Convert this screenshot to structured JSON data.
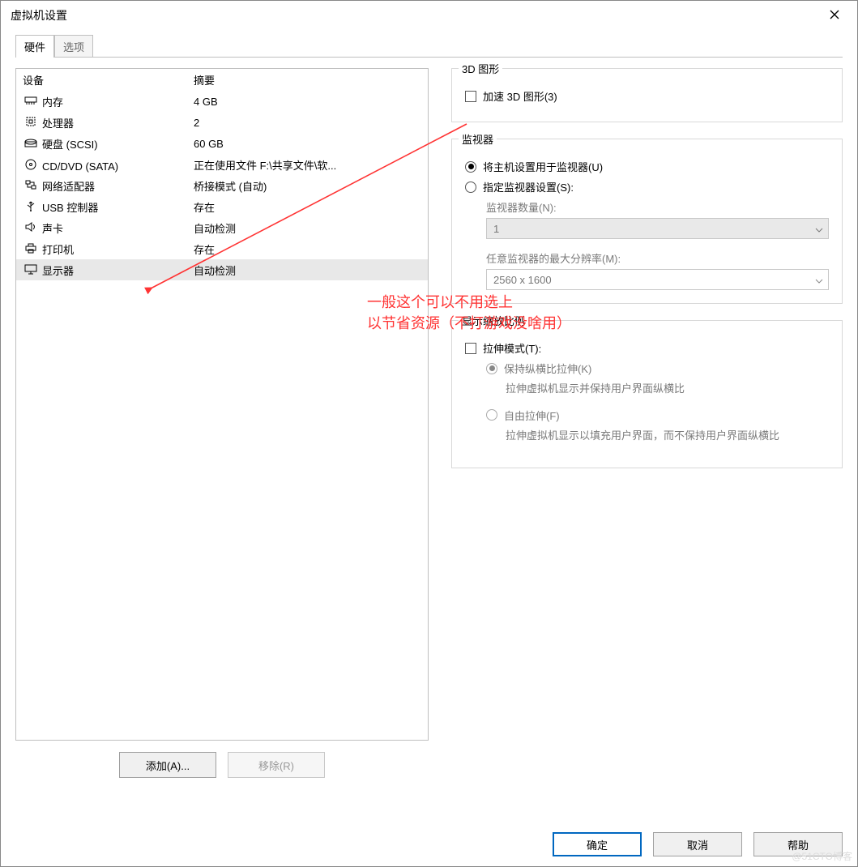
{
  "dialog": {
    "title": "虚拟机设置"
  },
  "tabs": {
    "hardware": "硬件",
    "options": "选项"
  },
  "deviceTable": {
    "header": {
      "device": "设备",
      "summary": "摘要"
    },
    "rows": [
      {
        "name": "内存",
        "summary": "4 GB",
        "icon": "memory"
      },
      {
        "name": "处理器",
        "summary": "2",
        "icon": "cpu"
      },
      {
        "name": "硬盘 (SCSI)",
        "summary": "60 GB",
        "icon": "hdd"
      },
      {
        "name": "CD/DVD (SATA)",
        "summary": "正在使用文件 F:\\共享文件\\软...",
        "icon": "cd"
      },
      {
        "name": "网络适配器",
        "summary": "桥接模式 (自动)",
        "icon": "net"
      },
      {
        "name": "USB 控制器",
        "summary": "存在",
        "icon": "usb"
      },
      {
        "name": "声卡",
        "summary": "自动检测",
        "icon": "sound"
      },
      {
        "name": "打印机",
        "summary": "存在",
        "icon": "printer"
      },
      {
        "name": "显示器",
        "summary": "自动检测",
        "icon": "display"
      }
    ]
  },
  "buttons": {
    "add": "添加(A)...",
    "remove": "移除(R)",
    "ok": "确定",
    "cancel": "取消",
    "help": "帮助"
  },
  "graphics3d": {
    "title": "3D 图形",
    "accel": "加速 3D 图形(3)"
  },
  "monitors": {
    "title": "监视器",
    "useHost": "将主机设置用于监视器(U)",
    "specify": "指定监视器设置(S):",
    "countLabel": "监视器数量(N):",
    "countValue": "1",
    "maxResLabel": "任意监视器的最大分辨率(M):",
    "maxResValue": "2560 x 1600"
  },
  "scaling": {
    "title": "显示缩放比例",
    "stretchMode": "拉伸模式(T):",
    "keepAspect": "保持纵横比拉伸(K)",
    "keepAspectDesc": "拉伸虚拟机显示并保持用户界面纵横比",
    "freeStretch": "自由拉伸(F)",
    "freeStretchDesc": "拉伸虚拟机显示以填充用户界面，而不保持用户界面纵横比"
  },
  "annotation": {
    "line1": "一般这个可以不用选上",
    "line2": "以节省资源（不打游戏没啥用）"
  },
  "watermark": "@51CTO博客"
}
